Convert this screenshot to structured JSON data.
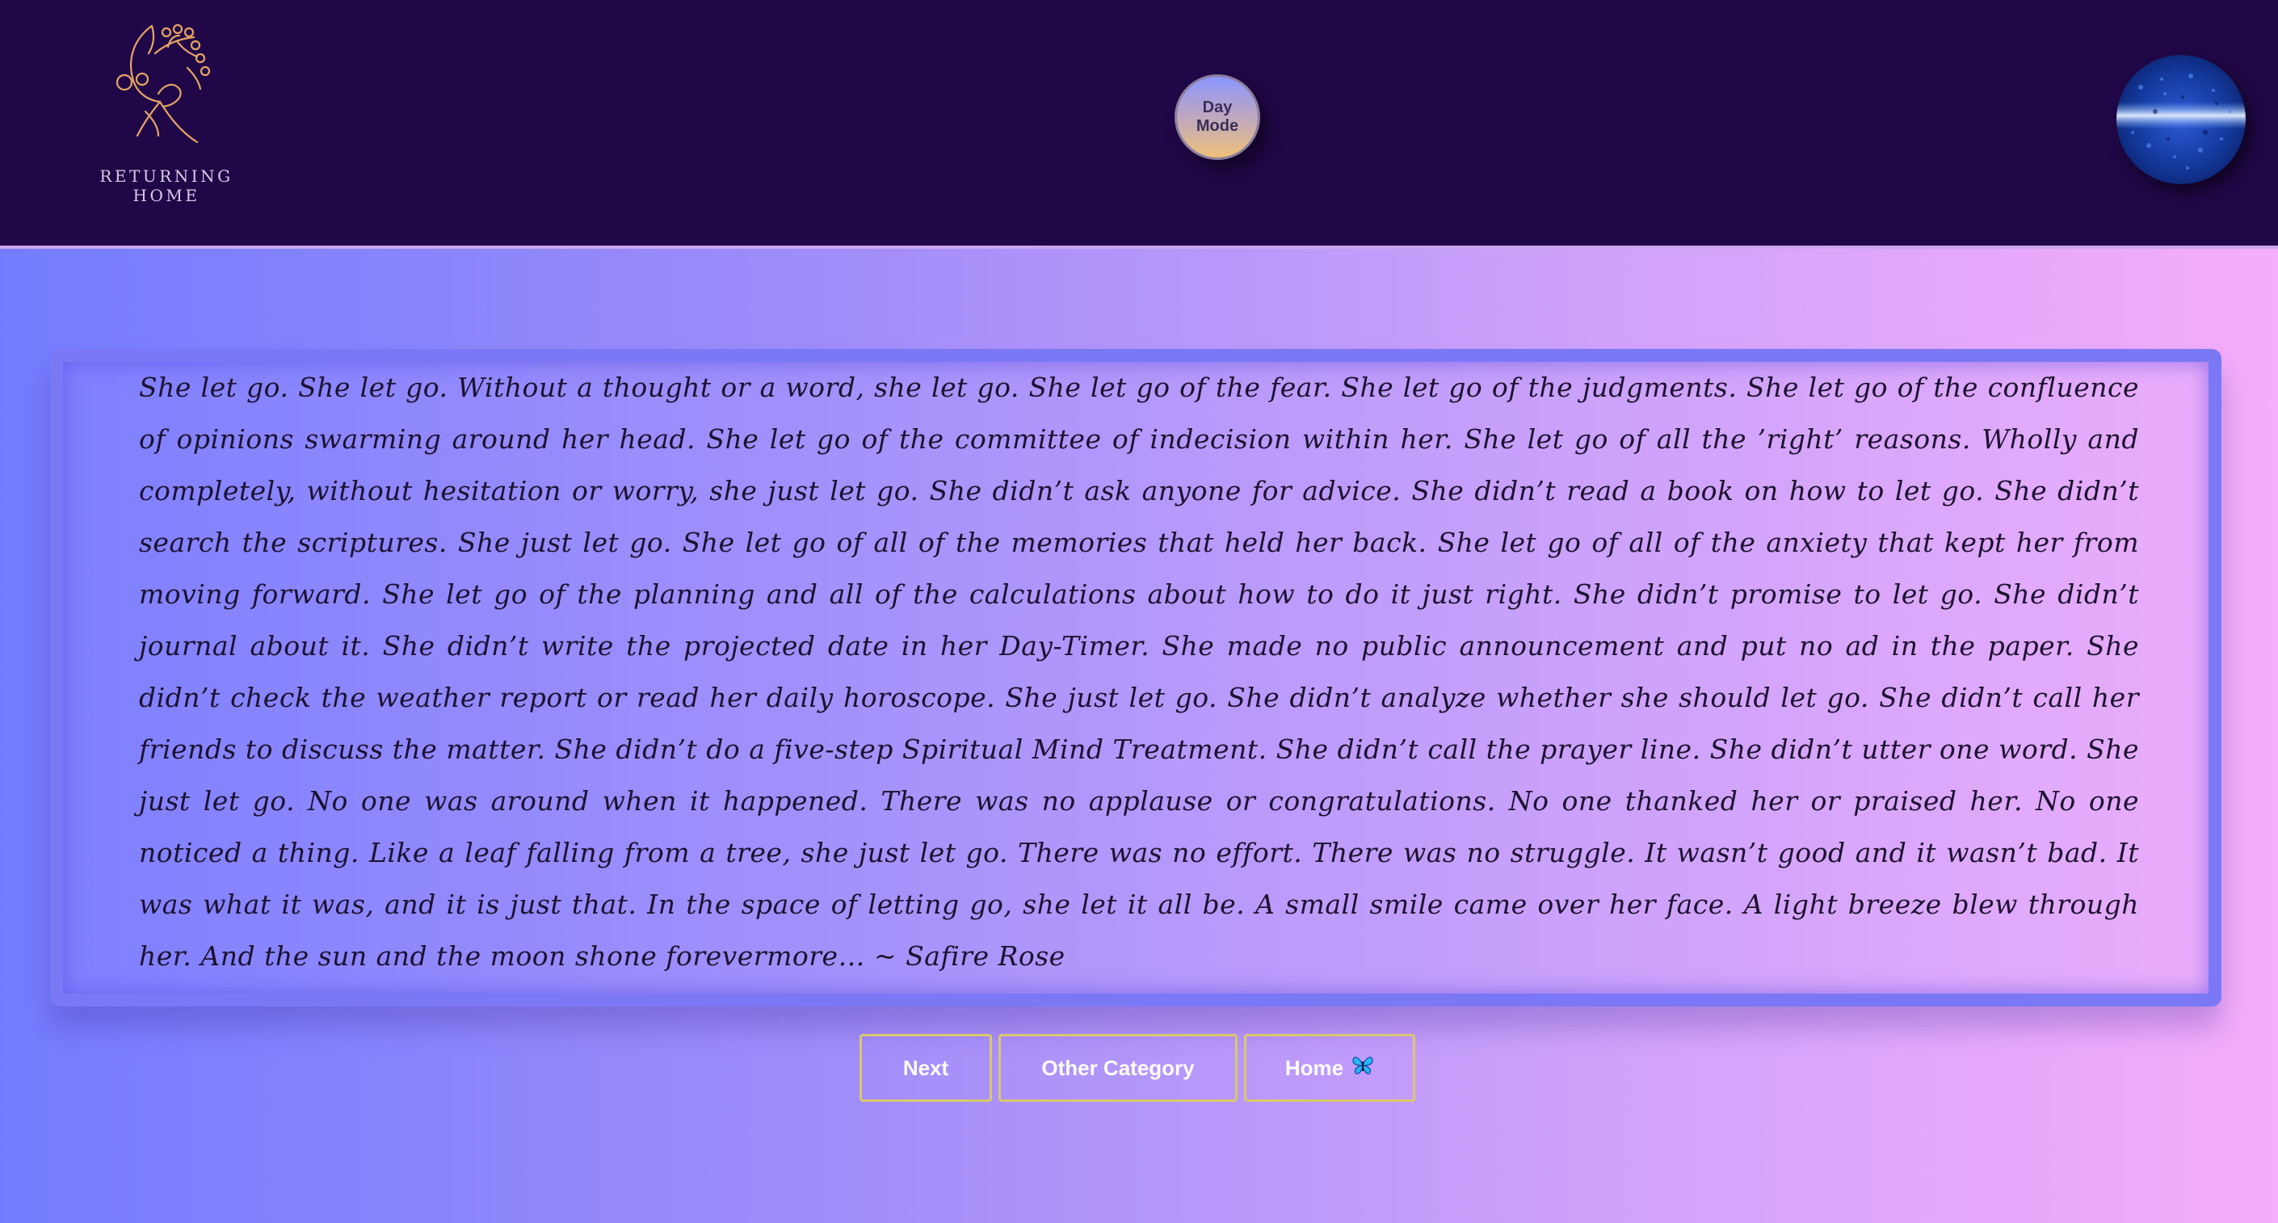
{
  "header": {
    "logo_text": "RETURNING HOME",
    "mode_toggle": {
      "line1": "Day",
      "line2": "Mode"
    },
    "avatar_icon": "moon-globe-icon"
  },
  "quote": {
    "text": "She let go. She let go. Without a thought or a word, she let go. She let go of the fear. She let go of the judgments. She let go of the confluence of opinions swarming around her head. She let go of the committee of indecision within her. She let go of all the ’right’ reasons. Wholly and completely, without hesitation or worry, she just let go. She didn’t ask anyone for advice. She didn’t read a book on how to let go. She didn’t search the scriptures. She just let go. She let go of all of the memories that held her back. She let go of all of the anxiety that kept her from moving forward. She let go of the planning and all of the calculations about how to do it just right. She didn’t promise to let go. She didn’t journal about it. She didn’t write the projected date in her Day-Timer. She made no public announcement and put no ad in the paper. She didn’t check the weather report or read her daily horoscope. She just let go. She didn’t analyze whether she should let go. She didn’t call her friends to discuss the matter. She didn’t do a five-step Spiritual Mind Treatment. She didn’t call the prayer line. She didn’t utter one word. She just let go. No one was around when it happened. There was no applause or congratulations. No one thanked her or praised her. No one noticed a thing. Like a leaf falling from a tree, she just let go. There was no effort. There was no struggle. It wasn’t good and it wasn’t bad. It was what it was, and it is just that. In the space of letting go, she let it all be. A small smile came over her face. A light breeze blew through her. And the sun and the moon shone forevermore… ~ Safire Rose"
  },
  "actions": {
    "next_label": "Next",
    "other_label": "Other Category",
    "home_label": "Home",
    "home_icon": "butterfly-icon"
  },
  "colors": {
    "header_bg": "#200747",
    "button_border": "#d9c86e",
    "gradient_start": "#737cff",
    "gradient_end": "#f6adfb"
  }
}
